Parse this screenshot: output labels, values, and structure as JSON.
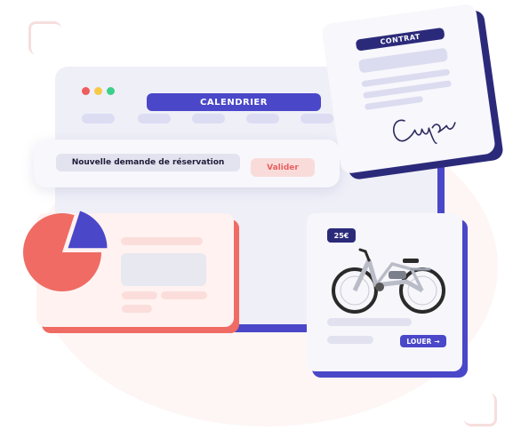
{
  "calendar": {
    "title": "CALENDRIER"
  },
  "booking_request": {
    "label": "Nouvelle demande de réservation",
    "validate_label": "Valider"
  },
  "contract": {
    "title": "CONTRAT"
  },
  "bike_offer": {
    "price": "25€",
    "rent_label": "LOUER",
    "rent_arrow": "→"
  },
  "stats": {
    "chart_data": {
      "type": "pie",
      "values": [
        0.8,
        0.2
      ],
      "colors": [
        "#ef6b63",
        "#4a47c9"
      ]
    }
  },
  "colors": {
    "primary": "#4a47c9",
    "dark_navy": "#2b2a7a",
    "coral": "#ef6b63",
    "soft_bg": "#efeff8"
  }
}
